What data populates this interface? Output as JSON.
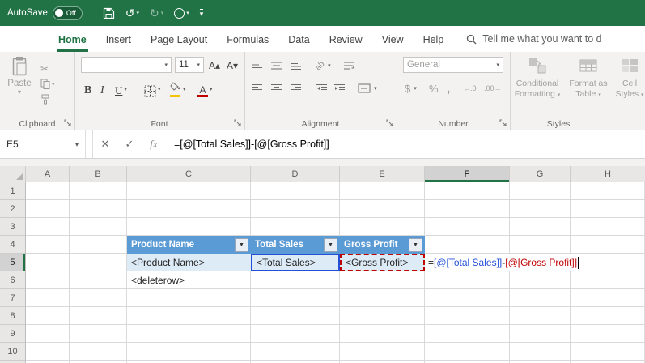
{
  "colors": {
    "excel_green": "#217346",
    "table_header_blue": "#5b9bd5",
    "banded_row_blue": "#ddebf7",
    "ref_blue": "#2450d8",
    "ref_red": "#c00000",
    "disabled_text": "#a19f9d"
  },
  "glyphs": {
    "caret_down": "▾",
    "undo": "↺",
    "redo": "↻",
    "cut": "✂",
    "cancel": "✕",
    "enter": "✓",
    "fx": "fx",
    "filter": "▼",
    "dollar": "$",
    "percent": "%",
    "comma": ",",
    "increase_decimal": "←.0",
    "decrease_decimal": ".00→",
    "bold": "B",
    "italic": "I",
    "underline": "U",
    "grow_font": "A▴",
    "shrink_font": "A▾",
    "orientation": "ab"
  },
  "title_bar": {
    "autosave_label": "AutoSave",
    "autosave_state": "Off"
  },
  "tab_bar": {
    "active_tab": "Home",
    "tabs": [
      {
        "label": "Home"
      },
      {
        "label": "Insert"
      },
      {
        "label": "Page Layout"
      },
      {
        "label": "Formulas"
      },
      {
        "label": "Data"
      },
      {
        "label": "Review"
      },
      {
        "label": "View"
      },
      {
        "label": "Help"
      }
    ],
    "tell_me": "Tell me what you want to d"
  },
  "ribbon": {
    "clipboard": {
      "group_label": "Clipboard",
      "paste_label": "Paste"
    },
    "font": {
      "group_label": "Font",
      "font_name": "",
      "font_size": "11"
    },
    "alignment": {
      "group_label": "Alignment"
    },
    "number": {
      "group_label": "Number",
      "format": "General"
    },
    "styles": {
      "group_label": "Styles",
      "buttons": [
        {
          "line1": "Conditional",
          "line2": "Formatting"
        },
        {
          "line1": "Format as",
          "line2": "Table"
        },
        {
          "line1": "Cell",
          "line2": "Styles"
        }
      ]
    }
  },
  "formula_bar": {
    "name_box": "E5",
    "formula": "=[@[Total Sales]]-[@[Gross Profit]]"
  },
  "sheet": {
    "column_headers": [
      "A",
      "B",
      "C",
      "D",
      "E",
      "F",
      "G",
      "H"
    ],
    "row_headers": [
      "1",
      "2",
      "3",
      "4",
      "5",
      "6",
      "7",
      "8",
      "9",
      "10"
    ],
    "active_column": "F",
    "active_row": "5",
    "table": {
      "header_cells": [
        "Product Name",
        "Total Sales",
        "Gross Profit"
      ],
      "data_cells": [
        "<Product Name>",
        "<Total Sales>",
        "<Gross Profit>"
      ],
      "delete_row_cell": "<deleterow>"
    },
    "formula_parts": [
      {
        "text": "=",
        "color": "#000000"
      },
      {
        "text": "[@[Total Sales]]",
        "color": "#2450d8"
      },
      {
        "text": "-",
        "color": "#000000"
      },
      {
        "text": "[@[Gross Profit]]",
        "color": "#c00000"
      }
    ]
  }
}
